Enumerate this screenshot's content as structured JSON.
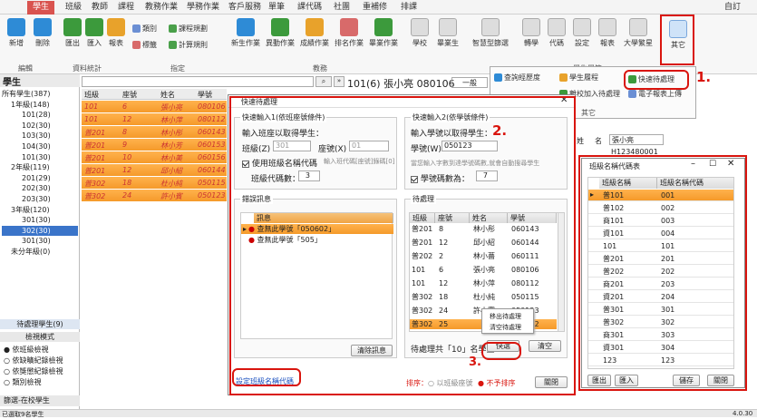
{
  "menu": {
    "tabs": [
      "學生",
      "班級",
      "教師",
      "課程",
      "教務作業",
      "學務作業",
      "客戶服務",
      "單筆",
      "課代碼",
      "社團",
      "重補修",
      "排課"
    ],
    "right": "自訂"
  },
  "ribbon": {
    "buttons": [
      {
        "label": "新增"
      },
      {
        "label": "刪除"
      },
      {
        "label": "匯出"
      },
      {
        "label": "匯入"
      },
      {
        "label": "報表"
      },
      {
        "label": "新生作業"
      },
      {
        "label": "異動作業"
      },
      {
        "label": "成績作業"
      },
      {
        "label": "排名作業"
      },
      {
        "label": "畢業作業"
      },
      {
        "label": "學校"
      },
      {
        "label": "畢業生"
      },
      {
        "label": "智慧型篩選"
      },
      {
        "label": "轉學"
      },
      {
        "label": "代碼"
      },
      {
        "label": "設定"
      },
      {
        "label": "報表"
      },
      {
        "label": "大學繁星"
      }
    ],
    "small_buttons": [
      "類別",
      "課程規劃",
      "標籤",
      "計算規則"
    ],
    "groups": [
      "編輯",
      "資料統計",
      "指定",
      "教務",
      "學生學籍"
    ],
    "popup": {
      "items": [
        "查詢經歷度",
        "學生履程",
        "快速待處理",
        "電子報表上傳",
        "離校加入待處理"
      ],
      "group": "其它"
    },
    "other_label": "其它"
  },
  "left": {
    "title": "學生",
    "tree": [
      "所有學生(387)",
      "1年級(148)",
      "101(28)",
      "102(30)",
      "103(30)",
      "104(30)",
      "101(30)",
      "2年級(119)",
      "201(29)",
      "202(30)",
      "203(30)",
      "3年級(120)",
      "301(30)",
      "302(30)",
      "301(30)",
      "未分年級(0)"
    ],
    "pending": "待處理學生(9)",
    "view_mode": "檢視模式",
    "options": [
      "依班級檢視",
      "依缺曠紀錄檢視",
      "依獎懲紀錄檢視",
      "類別檢視"
    ],
    "bottom": "篩選-在校學生",
    "status": "已選取9名學生"
  },
  "list": {
    "headers": [
      "班級",
      "座號",
      "姓名",
      "學號"
    ],
    "rows": [
      [
        "101",
        "6",
        "張小亮",
        "080106"
      ],
      [
        "101",
        "12",
        "林小萍",
        "080112"
      ],
      [
        "普201",
        "8",
        "林小彤",
        "060143"
      ],
      [
        "普201",
        "9",
        "林小芳",
        "060153"
      ],
      [
        "普201",
        "10",
        "林小美",
        "060156"
      ],
      [
        "普201",
        "12",
        "邱小紹",
        "060144"
      ],
      [
        "普302",
        "18",
        "杜小純",
        "050115"
      ],
      [
        "普302",
        "24",
        "許小賓",
        "050123"
      ]
    ]
  },
  "search": {
    "placeholder": ""
  },
  "detail": {
    "title": "101(6) 張小亮 080106",
    "mode": "一般",
    "name_label": "姓",
    "name2_label": "名",
    "name_value": "張小亮",
    "id_value": "H123480001"
  },
  "dialog": {
    "title": "快速待處理",
    "g1": {
      "title": "快速輸入1(依班座號條件)",
      "prompt": "輸入班座以取得學生：",
      "class_label": "班級(Z)",
      "class_value": "301",
      "seat_label": "座號(X)",
      "seat_value": "01",
      "use_code": "使用班級名稱代碼",
      "hint": "輸入班代碼[座號]錄碼[0]",
      "digits_label": "班級代碼數：",
      "digits_value": "3"
    },
    "g2": {
      "title": "快速輸入2(依學號條件)",
      "prompt": "輸入學號以取得學生：",
      "sid_label": "學號(W)",
      "sid_value": "050123",
      "hint": "當您輸入字數到達學號碼數,就會自動搜尋學生",
      "digits_label": "學號碼數為：",
      "digits_value": "7"
    },
    "errors": {
      "title": "錯誤訊息",
      "header": "訊息",
      "items": [
        "查無此學號「050602」",
        "查無此學號「505」"
      ],
      "clear": "清除訊息"
    },
    "pending": {
      "title": "待處理",
      "headers": [
        "班級",
        "座號",
        "姓名",
        "學號"
      ],
      "rows": [
        [
          "普201",
          "8",
          "林小彤",
          "060143"
        ],
        [
          "普201",
          "12",
          "邱小紹",
          "060144"
        ],
        [
          "普202",
          "2",
          "林小薔",
          "060111"
        ],
        [
          "101",
          "6",
          "張小亮",
          "080106"
        ],
        [
          "101",
          "12",
          "林小萍",
          "080112"
        ],
        [
          "普302",
          "18",
          "杜小純",
          "050115"
        ],
        [
          "普302",
          "24",
          "許小賓",
          "050123"
        ],
        [
          "普302",
          "25",
          "",
          "060122"
        ]
      ],
      "count": "待處理共「10」名學生",
      "quick": "快選",
      "clear": "清空",
      "context": [
        "移出待處理",
        "清空待處理"
      ]
    },
    "link": "設定班級名稱代碼",
    "sort_label": "排序：",
    "sort_opts": [
      "以班級座號",
      "不予排序"
    ],
    "close": "關閉"
  },
  "codes": {
    "title": "班級名稱代碼表",
    "headers": [
      "班級名稱",
      "班級名稱代碼"
    ],
    "rows": [
      [
        "普101",
        "001"
      ],
      [
        "普102",
        "002"
      ],
      [
        "商101",
        "003"
      ],
      [
        "資101",
        "004"
      ],
      [
        "101",
        "101"
      ],
      [
        "普201",
        "201"
      ],
      [
        "普202",
        "202"
      ],
      [
        "商201",
        "203"
      ],
      [
        "資201",
        "204"
      ],
      [
        "普301",
        "301"
      ],
      [
        "普302",
        "302"
      ],
      [
        "商301",
        "303"
      ],
      [
        "資301",
        "304"
      ],
      [
        "123",
        "123"
      ]
    ],
    "buttons": [
      "匯出",
      "匯入",
      "儲存",
      "關閉"
    ]
  },
  "annotations": {
    "n1": "1.",
    "n2": "2.",
    "n3": "3."
  },
  "version": "4.0.30",
  "colors": {
    "accent": "#d9534f",
    "highlight": "#f59a2a",
    "select": "#3a74c9",
    "annot": "#d9150e"
  }
}
